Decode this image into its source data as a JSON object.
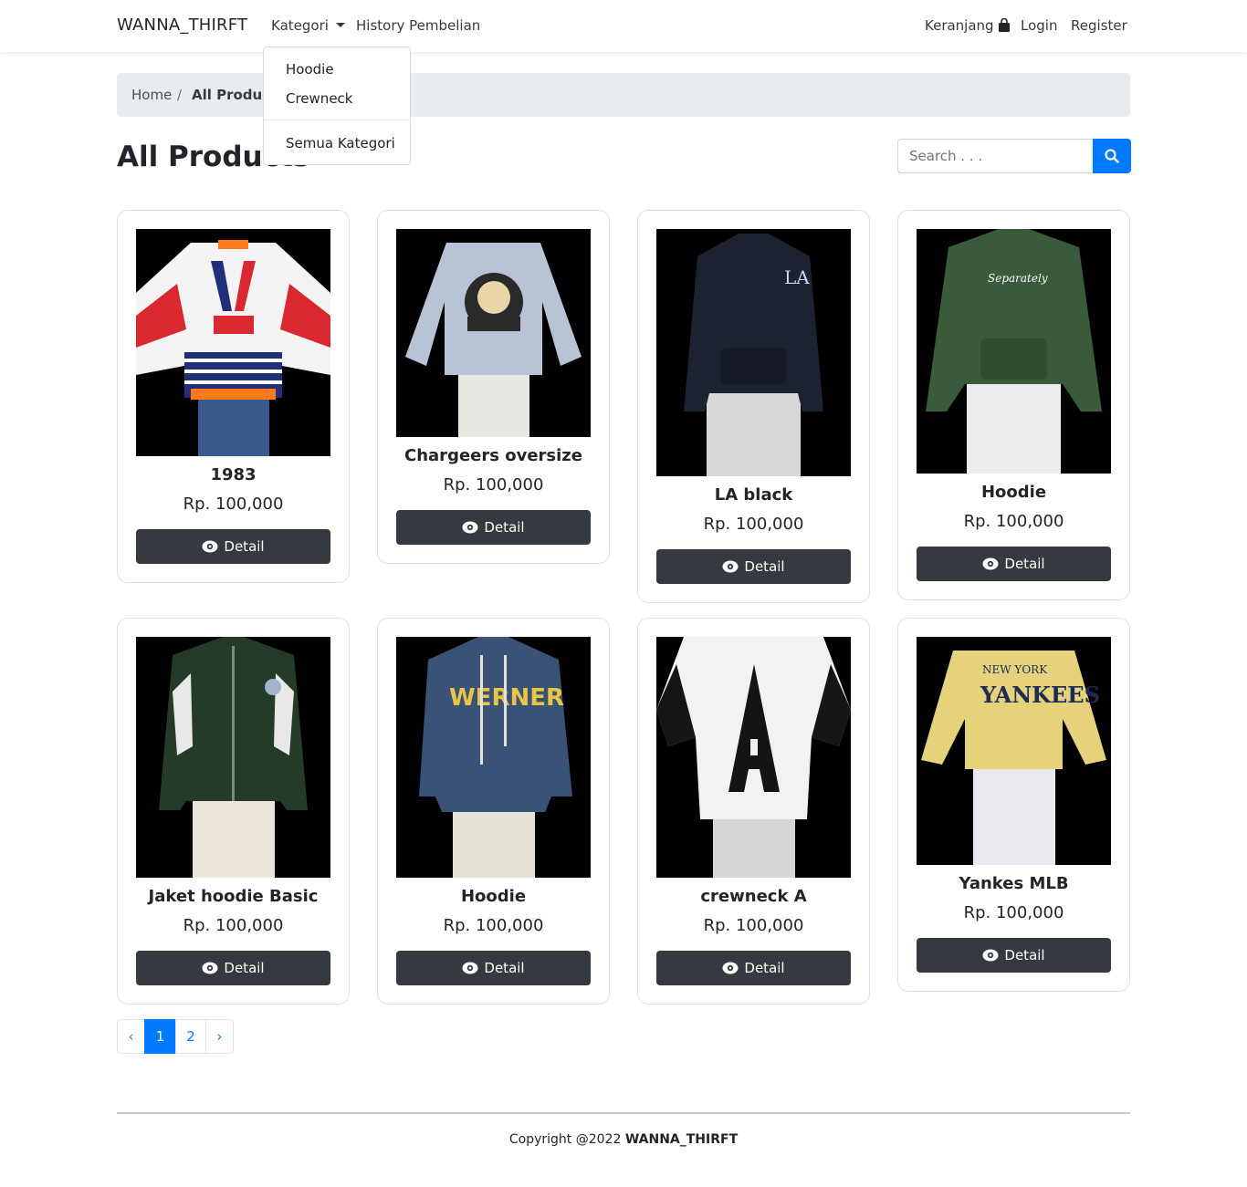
{
  "navbar": {
    "brand": "WANNA_THIRFT",
    "kategori": "Kategori",
    "history": "History Pembelian",
    "cart": "Keranjang",
    "login": "Login",
    "register": "Register"
  },
  "dropdown": {
    "items": [
      "Hoodie",
      "Crewneck"
    ],
    "all": "Semua Kategori"
  },
  "breadcrumb": {
    "home": "Home",
    "separator": "/",
    "active": "All Products"
  },
  "page_title": "All Products",
  "search": {
    "placeholder": "Search . . ."
  },
  "detail_label": "Detail",
  "products": [
    {
      "name": "1983",
      "price": "Rp. 100,000"
    },
    {
      "name": "Chargeers oversize",
      "price": "Rp. 100,000"
    },
    {
      "name": "LA black",
      "price": "Rp. 100,000"
    },
    {
      "name": "Hoodie",
      "price": "Rp. 100,000"
    },
    {
      "name": "Jaket hoodie Basic",
      "price": "Rp. 100,000"
    },
    {
      "name": "Hoodie",
      "price": "Rp. 100,000"
    },
    {
      "name": "crewneck A",
      "price": "Rp. 100,000"
    },
    {
      "name": "Yankes MLB",
      "price": "Rp. 100,000"
    }
  ],
  "pagination": {
    "prev": "‹",
    "pages": [
      "1",
      "2"
    ],
    "next": "›",
    "current": "1"
  },
  "footer": {
    "copyright": "Copyright @2022",
    "brand": "WANNA_THIRFT"
  },
  "colors": {
    "primary": "#007bff",
    "dark": "#343a40",
    "breadcrumb_bg": "#e9ecef"
  }
}
